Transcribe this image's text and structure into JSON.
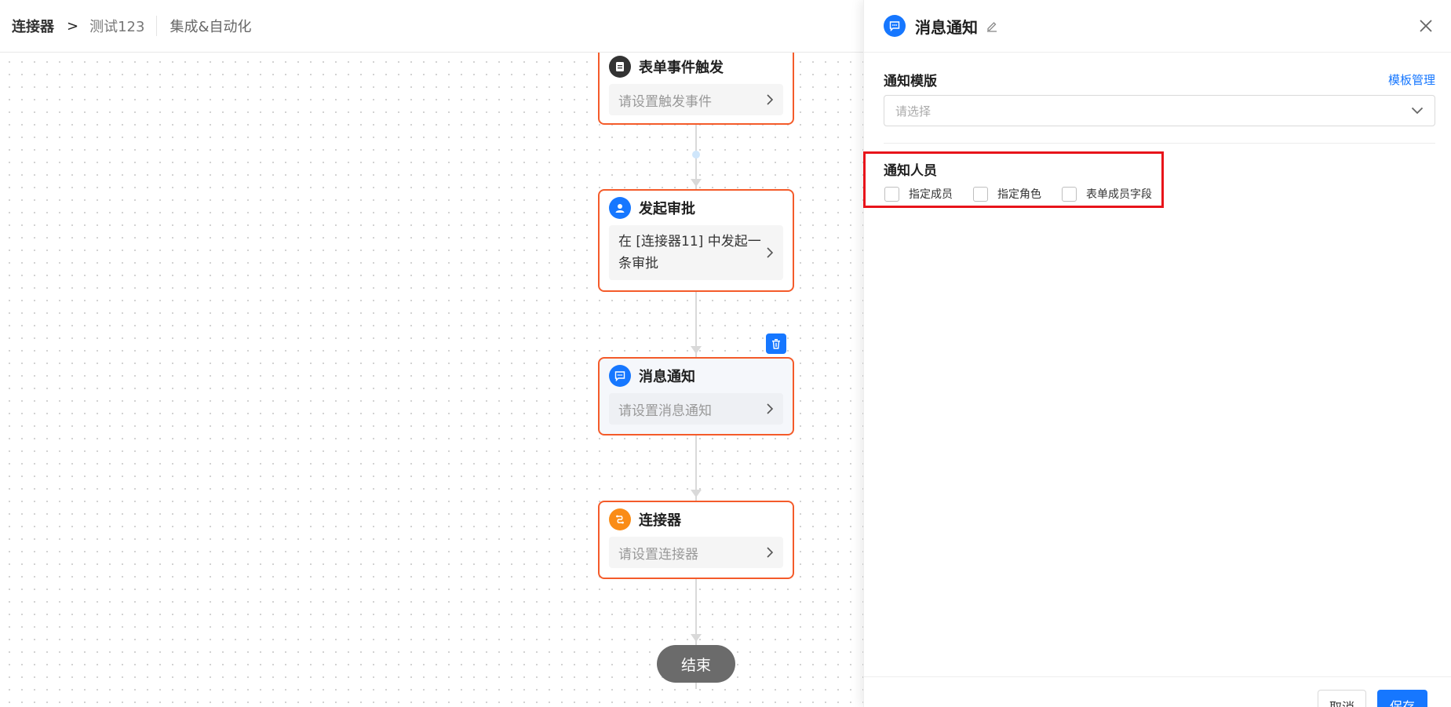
{
  "breadcrumb": {
    "root": "连接器",
    "separator": ">",
    "current": "测试123",
    "section": "集成&自动化"
  },
  "flow": {
    "nodes": [
      {
        "id": "trigger",
        "title": "表单事件触发",
        "body": "请设置触发事件",
        "icon": "document-icon",
        "icon_color": "#333333"
      },
      {
        "id": "approval",
        "title": "发起审批",
        "body": "在 [连接器11] 中发起一条审批",
        "icon": "user-icon",
        "icon_color": "#1677ff"
      },
      {
        "id": "notify",
        "title": "消息通知",
        "body": "请设置消息通知",
        "icon": "message-icon",
        "icon_color": "#1677ff"
      },
      {
        "id": "connector",
        "title": "连接器",
        "body": "请设置连接器",
        "icon": "connector-icon",
        "icon_color": "#fa8c16"
      }
    ],
    "end_label": "结束"
  },
  "panel": {
    "title": "消息通知",
    "template": {
      "label": "通知模版",
      "manage_link": "模板管理",
      "placeholder": "请选择"
    },
    "recipients": {
      "label": "通知人员",
      "options": [
        "指定成员",
        "指定角色",
        "表单成员字段"
      ]
    },
    "footer": {
      "cancel": "取消",
      "save": "保存"
    }
  },
  "colors": {
    "accent": "#1677ff",
    "node_border": "#f45b2a",
    "highlight": "#e8141a"
  }
}
